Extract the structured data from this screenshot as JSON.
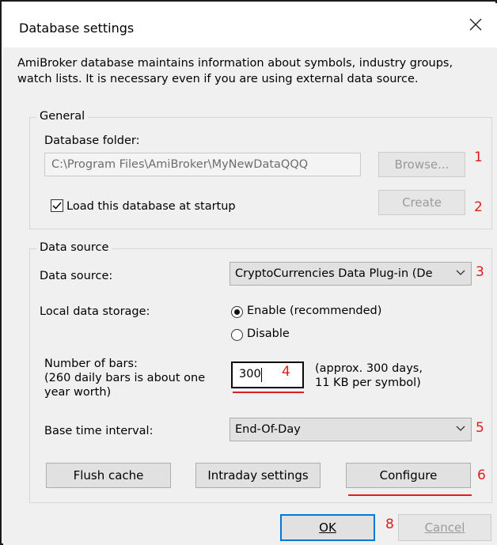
{
  "window": {
    "title": "Database settings"
  },
  "intro": {
    "line1": "AmiBroker database maintains information about symbols, industry groups,",
    "line2": "watch lists. It is necessary even if you are using external data source."
  },
  "general": {
    "label": "General",
    "folder_label": "Database folder:",
    "folder_value": "C:\\Program Files\\AmiBroker\\MyNewDataQQQ",
    "browse_label": "Browse...",
    "create_label": "Create",
    "load_startup_label": "Load this database at startup",
    "load_startup_checked": true
  },
  "datasource": {
    "label": "Data source",
    "source_label": "Data source:",
    "source_value": "CryptoCurrencies Data Plug-in (De",
    "local_storage_label": "Local data storage:",
    "enable_label": "Enable (recommended)",
    "disable_label": "Disable",
    "selected_storage": "enable",
    "bars_label_1": "Number of bars:",
    "bars_label_2": "(260 daily bars is about one",
    "bars_label_3": "year worth)",
    "bars_value": "300",
    "approx_1": "(approx. 300 days,",
    "approx_2": "11 KB per symbol)",
    "interval_label": "Base time interval:",
    "interval_value": "End-Of-Day",
    "flush_label": "Flush cache",
    "intraday_label": "Intraday settings",
    "configure_label": "Configure"
  },
  "footer": {
    "ok_label": "OK",
    "cancel_label": "Cancel"
  },
  "annotations": [
    "1",
    "2",
    "3",
    "4",
    "5",
    "6",
    "8"
  ],
  "colors": {
    "annotation": "#e01c1c",
    "focus": "#0078d7"
  }
}
